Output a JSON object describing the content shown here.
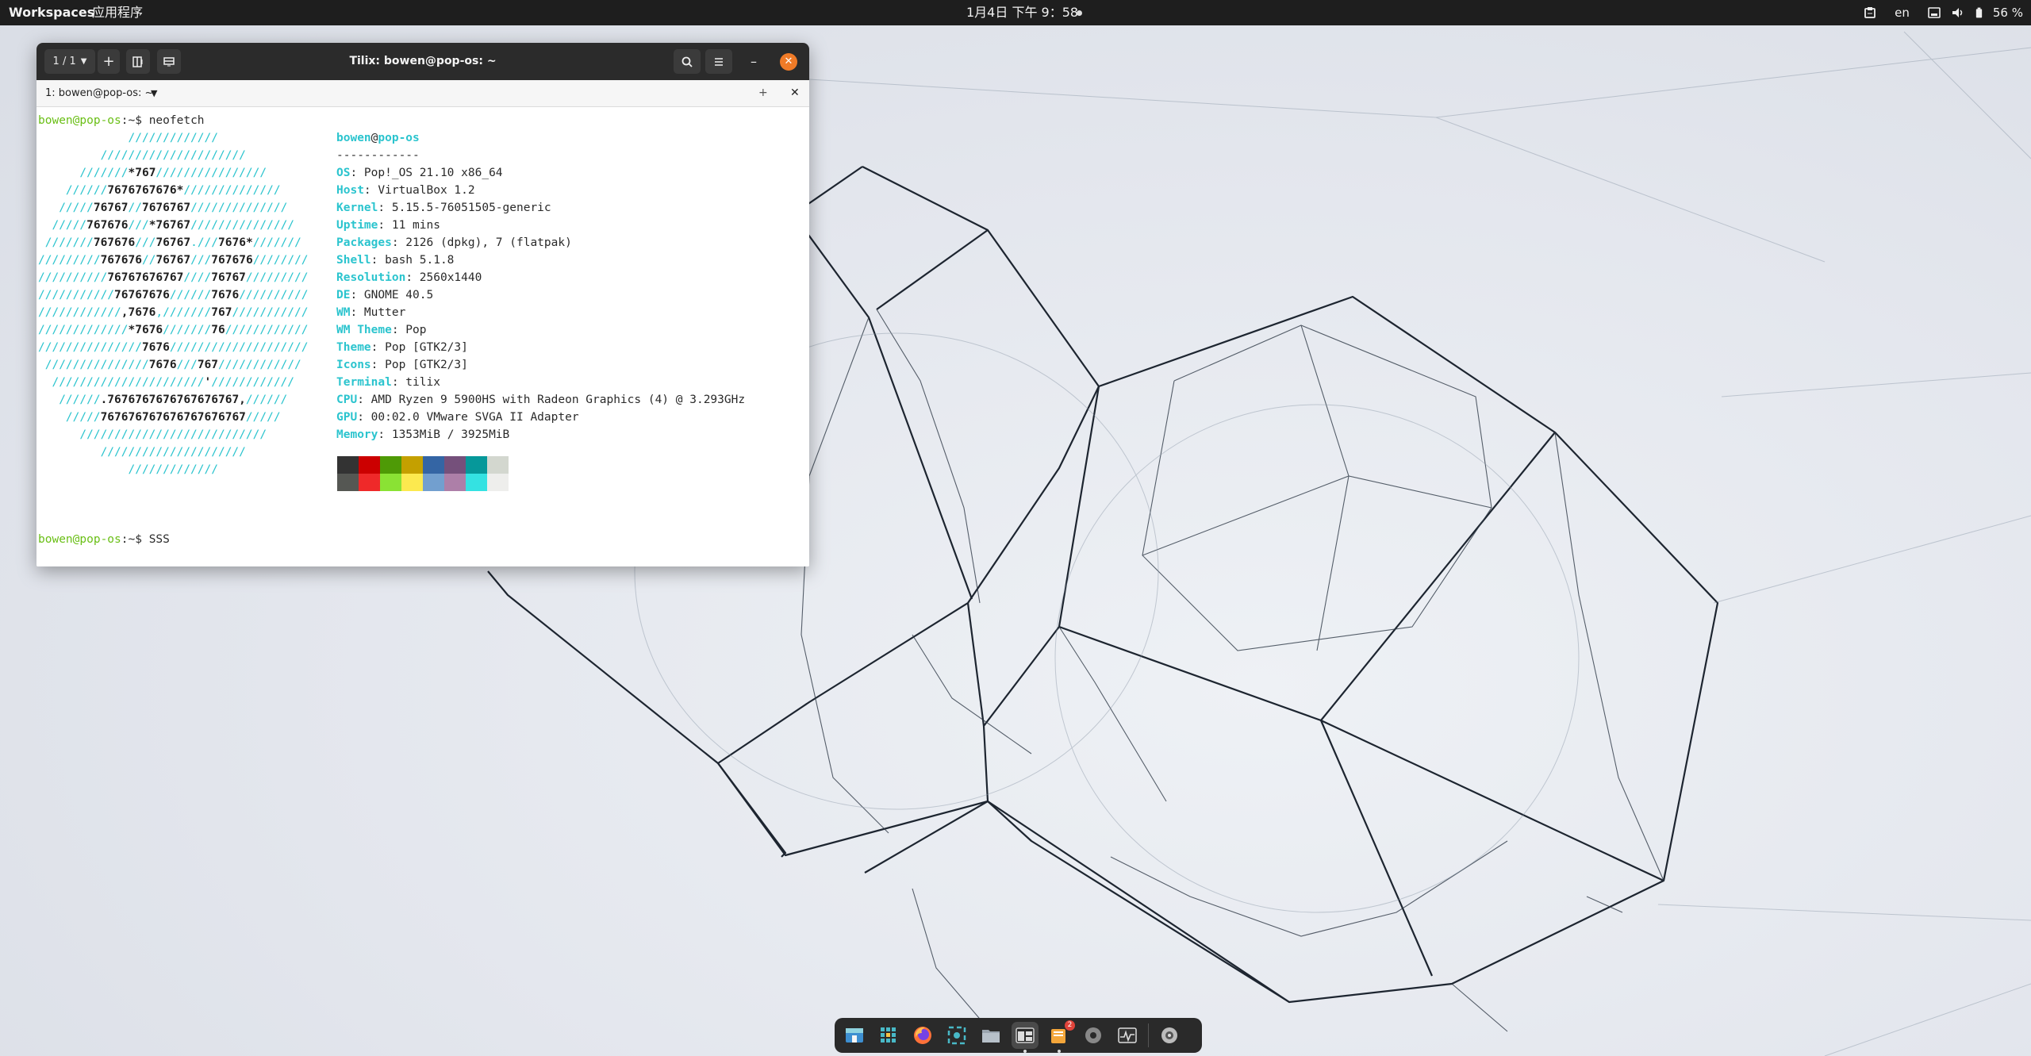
{
  "topbar": {
    "workspaces": "Workspaces",
    "apps": "应用程序",
    "clock": "1月4日 下午 9：58",
    "lang": "en",
    "battery": "56 %",
    "icons": [
      "clipboard-icon",
      "network-icon",
      "volume-icon",
      "battery-icon"
    ]
  },
  "window": {
    "title": "Tilix: bowen@pop-os: ~",
    "session": "1 / 1",
    "tab_label": "1: bowen@pop-os: ~"
  },
  "terminal": {
    "prompt_user": "bowen@pop-os",
    "prompt_path": ":~",
    "command1": "$ neofetch",
    "command2": "$ SSS",
    "header_user": "bowen",
    "header_at": "@",
    "header_host": "pop-os",
    "separator": "------------",
    "info": [
      {
        "k": "OS",
        "v": ": Pop!_OS 21.10 x86_64"
      },
      {
        "k": "Host",
        "v": ": VirtualBox 1.2"
      },
      {
        "k": "Kernel",
        "v": ": 5.15.5-76051505-generic"
      },
      {
        "k": "Uptime",
        "v": ": 11 mins"
      },
      {
        "k": "Packages",
        "v": ": 2126 (dpkg), 7 (flatpak)"
      },
      {
        "k": "Shell",
        "v": ": bash 5.1.8"
      },
      {
        "k": "Resolution",
        "v": ": 2560x1440"
      },
      {
        "k": "DE",
        "v": ": GNOME 40.5"
      },
      {
        "k": "WM",
        "v": ": Mutter"
      },
      {
        "k": "WM Theme",
        "v": ": Pop"
      },
      {
        "k": "Theme",
        "v": ": Pop [GTK2/3]"
      },
      {
        "k": "Icons",
        "v": ": Pop [GTK2/3]"
      },
      {
        "k": "Terminal",
        "v": ": tilix"
      },
      {
        "k": "CPU",
        "v": ": AMD Ryzen 9 5900HS with Radeon Graphics (4) @ 3.293GHz"
      },
      {
        "k": "GPU",
        "v": ": 00:02.0 VMware SVGA II Adapter"
      },
      {
        "k": "Memory",
        "v": ": 1353MiB / 3925MiB"
      }
    ],
    "ascii": [
      [
        [
          "c",
          "             /////////////"
        ]
      ],
      [
        [
          "c",
          "         /////////////////////"
        ]
      ],
      [
        [
          "c",
          "      ///////"
        ],
        [
          "b",
          "*767"
        ],
        [
          "c",
          "////////////////"
        ]
      ],
      [
        [
          "c",
          "    //////"
        ],
        [
          "b",
          "7676767676*"
        ],
        [
          "c",
          "//////////////"
        ]
      ],
      [
        [
          "c",
          "   /////"
        ],
        [
          "b",
          "76767"
        ],
        [
          "c",
          "//"
        ],
        [
          "b",
          "7676767"
        ],
        [
          "c",
          "//////////////"
        ]
      ],
      [
        [
          "c",
          "  /////"
        ],
        [
          "b",
          "767676"
        ],
        [
          "c",
          "///"
        ],
        [
          "b",
          "*76767"
        ],
        [
          "c",
          "///////////////"
        ]
      ],
      [
        [
          "c",
          " ///////"
        ],
        [
          "b",
          "767676"
        ],
        [
          "c",
          "///"
        ],
        [
          "b",
          "76767"
        ],
        [
          "c",
          "."
        ],
        [
          "c",
          "///"
        ],
        [
          "b",
          "7676*"
        ],
        [
          "c",
          "///////"
        ]
      ],
      [
        [
          "c",
          "/////////"
        ],
        [
          "b",
          "767676"
        ],
        [
          "c",
          "//"
        ],
        [
          "b",
          "76767"
        ],
        [
          "c",
          "///"
        ],
        [
          "b",
          "767676"
        ],
        [
          "c",
          "////////"
        ]
      ],
      [
        [
          "c",
          "//////////"
        ],
        [
          "b",
          "76767676767"
        ],
        [
          "c",
          "////"
        ],
        [
          "b",
          "76767"
        ],
        [
          "c",
          "/////////"
        ]
      ],
      [
        [
          "c",
          "///////////"
        ],
        [
          "b",
          "76767676"
        ],
        [
          "c",
          "//////"
        ],
        [
          "b",
          "7676"
        ],
        [
          "c",
          "//////////"
        ]
      ],
      [
        [
          "c",
          "////////////"
        ],
        [
          "b",
          ",7676"
        ],
        [
          "c",
          ","
        ],
        [
          "c",
          "///////"
        ],
        [
          "b",
          "767"
        ],
        [
          "c",
          "///////////"
        ]
      ],
      [
        [
          "c",
          "/////////////"
        ],
        [
          "b",
          "*7676"
        ],
        [
          "c",
          "///////"
        ],
        [
          "b",
          "76"
        ],
        [
          "c",
          "////////////"
        ]
      ],
      [
        [
          "c",
          "///////////////"
        ],
        [
          "b",
          "7676"
        ],
        [
          "c",
          "////////////////////"
        ]
      ],
      [
        [
          "c",
          " ///////////////"
        ],
        [
          "b",
          "7676"
        ],
        [
          "c",
          "///"
        ],
        [
          "b",
          "767"
        ],
        [
          "c",
          "////////////"
        ]
      ],
      [
        [
          "c",
          "  //////////////////////"
        ],
        [
          "b",
          "'"
        ],
        [
          "c",
          "////////////"
        ]
      ],
      [
        [
          "c",
          "   //////"
        ],
        [
          "b",
          ".7676767676767676767,"
        ],
        [
          "c",
          "//////"
        ]
      ],
      [
        [
          "c",
          "    /////"
        ],
        [
          "b",
          "767676767676767676767"
        ],
        [
          "c",
          "/////"
        ]
      ],
      [
        [
          "c",
          "      ///////////////////////////"
        ]
      ],
      [
        [
          "c",
          "         /////////////////////"
        ]
      ],
      [
        [
          "c",
          "             /////////////"
        ]
      ]
    ],
    "palette_top": [
      "#333333",
      "#cc0000",
      "#4e9a06",
      "#c4a000",
      "#3465a4",
      "#75507b",
      "#06989a",
      "#d3d7cf"
    ],
    "palette_bottom": [
      "#555753",
      "#ef2929",
      "#8ae234",
      "#fce94f",
      "#729fcf",
      "#ad7fa8",
      "#34e2e2",
      "#eeeeec"
    ]
  },
  "dock": {
    "apps": [
      {
        "name": "pop-shop-icon",
        "color": "#3d8fd1"
      },
      {
        "name": "app-grid-icon",
        "color": "#48b9c7"
      },
      {
        "name": "firefox-icon",
        "color": "#ff7139"
      },
      {
        "name": "screenshot-icon",
        "color": "#48b9c7"
      },
      {
        "name": "files-icon",
        "color": "#9aa4ae"
      },
      {
        "name": "tilix-icon",
        "color": "#cccccc"
      },
      {
        "name": "notes-icon",
        "color": "#f4a63a"
      },
      {
        "name": "settings-icon",
        "color": "#bbbbbb"
      },
      {
        "name": "system-monitor-icon",
        "color": "#dddddd"
      },
      {
        "name": "disc-icon",
        "color": "#bbbbbb"
      }
    ],
    "badge": "2"
  }
}
